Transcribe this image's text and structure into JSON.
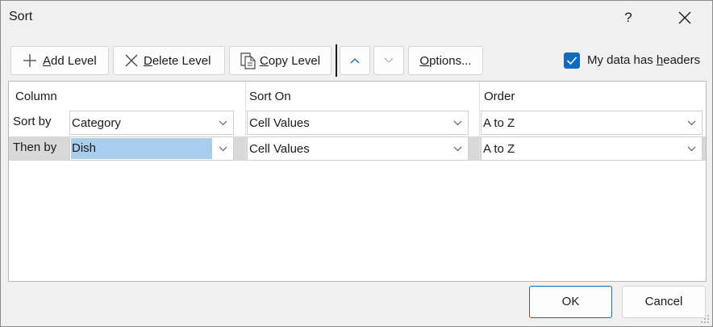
{
  "window": {
    "title": "Sort",
    "help_label": "?"
  },
  "toolbar": {
    "add_level": {
      "pre": "",
      "accel": "A",
      "post": "dd Level"
    },
    "delete_level": {
      "pre": "",
      "accel": "D",
      "post": "elete Level"
    },
    "copy_level": {
      "pre": "",
      "accel": "C",
      "post": "opy Level"
    },
    "options": {
      "pre": "",
      "accel": "O",
      "post": "ptions..."
    },
    "move_up_icon": "chevron-up-icon",
    "move_down_icon": "chevron-down-icon"
  },
  "headers_checkbox": {
    "checked": true,
    "label_pre": "My data has ",
    "label_accel": "h",
    "label_post": "eaders"
  },
  "grid": {
    "columns": [
      "Column",
      "Sort On",
      "Order"
    ],
    "rows": [
      {
        "label": "Sort by",
        "column": "Category",
        "sort_on": "Cell Values",
        "order": "A to Z",
        "selected": false
      },
      {
        "label": "Then by",
        "column": "Dish",
        "sort_on": "Cell Values",
        "order": "A to Z",
        "selected": true
      }
    ]
  },
  "footer": {
    "ok_label": "OK",
    "cancel_label": "Cancel"
  },
  "colors": {
    "accent": "#0f6cbd",
    "selection": "#a9cdec",
    "row_highlight": "#d9d9d9"
  }
}
